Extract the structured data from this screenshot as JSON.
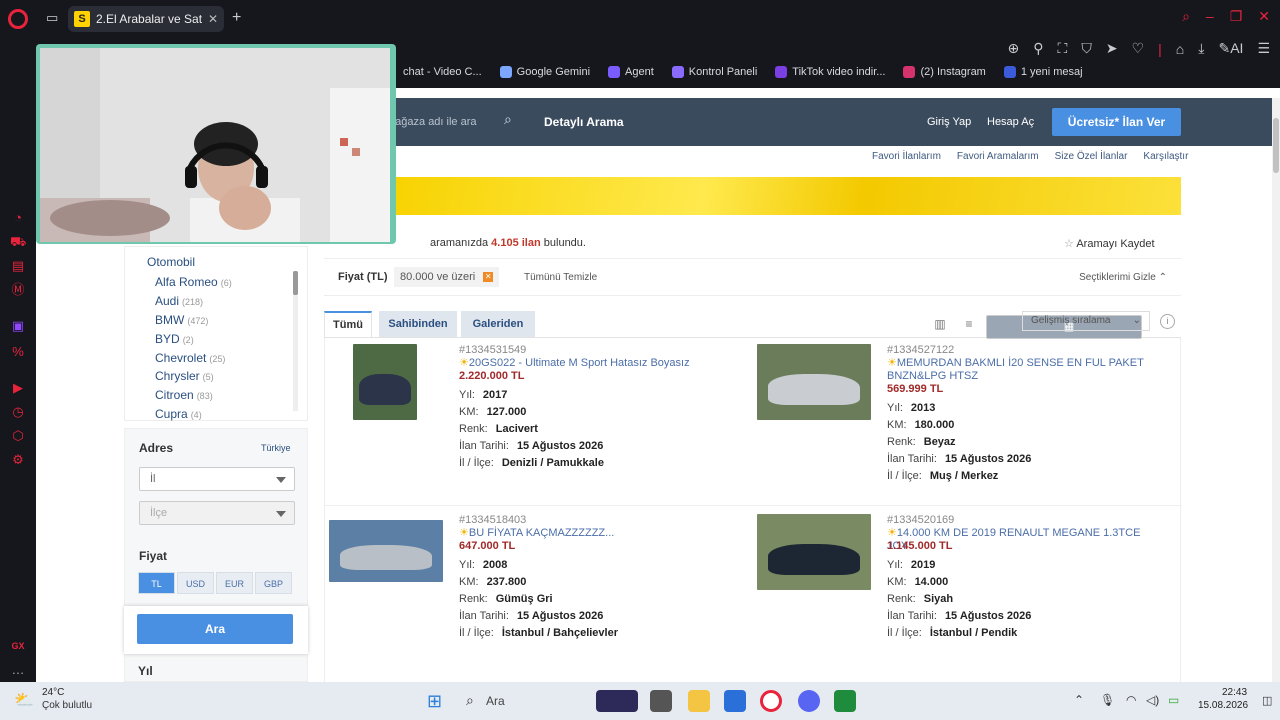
{
  "browser": {
    "tab_title": "2.El Arabalar ve Satılık Sıfır",
    "tab_favicon": "S",
    "bookmarks": [
      {
        "label": "chat - Video C...",
        "icon": "video-icon",
        "color": "#16171d"
      },
      {
        "label": "Google Gemini",
        "icon": "gemini-icon",
        "color": "#7da7ff"
      },
      {
        "label": "Agent",
        "icon": "agent-icon",
        "color": "#7b5cff"
      },
      {
        "label": "Kontrol Paneli",
        "icon": "panel-icon",
        "color": "#8a6bff"
      },
      {
        "label": "TikTok video indir...",
        "icon": "tiktok-icon",
        "color": "#7b3fe4"
      },
      {
        "label": "(2) Instagram",
        "icon": "instagram-icon",
        "color": "#d6336c"
      },
      {
        "label": "1 yeni mesaj",
        "icon": "message-icon",
        "color": "#3b5bdb"
      }
    ]
  },
  "header": {
    "search_placeholder": "mağaza adı ile ara",
    "detailed_search": "Detaylı Arama",
    "login": "Giriş Yap",
    "signup": "Hesap Aç",
    "post_ad": "Ücretsiz* İlan Ver"
  },
  "subnav": [
    "Favori İlanlarım",
    "Favori Aramalarım",
    "Size Özel İlanlar",
    "Karşılaştır"
  ],
  "results": {
    "prefix": "aramanızda",
    "count": "4.105 ilan",
    "suffix": "bulundu.",
    "save_search": "Aramayı Kaydet"
  },
  "filters": {
    "label": "Fiyat (TL)",
    "chip": "80.000 ve üzeri",
    "clear_all": "Tümünü Temizle",
    "hide": "Seçtiklerimi Gizle"
  },
  "tabs": [
    "Tümü",
    "Sahibinden",
    "Galeriden"
  ],
  "sort": "Gelişmiş sıralama",
  "left": {
    "category": "Otomobil",
    "brands": [
      {
        "name": "Alfa Romeo",
        "count": "(6)"
      },
      {
        "name": "Audi",
        "count": "(218)"
      },
      {
        "name": "BMW",
        "count": "(472)"
      },
      {
        "name": "BYD",
        "count": "(2)"
      },
      {
        "name": "Chevrolet",
        "count": "(25)"
      },
      {
        "name": "Chrysler",
        "count": "(5)"
      },
      {
        "name": "Citroen",
        "count": "(83)"
      },
      {
        "name": "Cupra",
        "count": "(4)"
      }
    ],
    "address_title": "Adres",
    "country": "Türkiye",
    "il": "İl",
    "ilce": "İlçe",
    "price_title": "Fiyat",
    "currencies": [
      "TL",
      "USD",
      "EUR",
      "GBP"
    ],
    "search_btn": "Ara",
    "year_title": "Yıl"
  },
  "labels": {
    "year": "Yıl:",
    "km": "KM:",
    "color": "Renk:",
    "date": "İlan Tarihi:",
    "location": "İl / İlçe:"
  },
  "listings": [
    {
      "id": "#1334531549",
      "title": "20GS022 - Ultimate M Sport Hatasız Boyasız",
      "price": "2.220.000 TL",
      "year": "2017",
      "km": "127.000",
      "color": "Lacivert",
      "date": "15 Ağustos 2026",
      "location": "Denizli / Pamukkale"
    },
    {
      "id": "#1334527122",
      "title": "MEMURDAN BAKMLI İ20 SENSE EN FUL PAKET BNZN&LPG HTSZ",
      "price": "569.999 TL",
      "year": "2013",
      "km": "180.000",
      "color": "Beyaz",
      "date": "15 Ağustos 2026",
      "location": "Muş / Merkez"
    },
    {
      "id": "#1334518403",
      "title": "BU FİYATA KAÇMAZZZZZZ...",
      "price": "647.000 TL",
      "year": "2008",
      "km": "237.800",
      "color": "Gümüş Gri",
      "date": "15 Ağustos 2026",
      "location": "İstanbul / Bahçelievler"
    },
    {
      "id": "#1334520169",
      "title": "14.000 KM DE 2019 RENAULT MEGANE 1.3TCE JOY",
      "price": "1.145.000 TL",
      "year": "2019",
      "km": "14.000",
      "color": "Siyah",
      "date": "15 Ağustos 2026",
      "location": "İstanbul / Pendik"
    }
  ],
  "taskbar": {
    "temp": "24°C",
    "weather": "Çok bulutlu",
    "search": "Ara",
    "time": "22:43",
    "date": "15.08.2026"
  }
}
